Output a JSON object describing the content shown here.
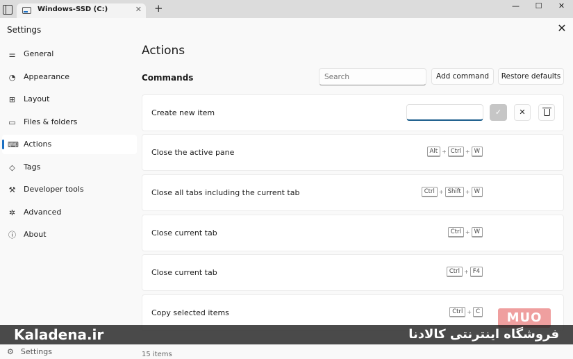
{
  "tab": {
    "label": "Windows-SSD (C:)",
    "close": "✕",
    "new": "+"
  },
  "window_controls": {
    "minimize": "—",
    "maximize": "☐",
    "close": "✕"
  },
  "dialog": {
    "title": "Settings",
    "close": "✕"
  },
  "sidebar": {
    "items": [
      {
        "label": "General",
        "icon": "sliders-icon"
      },
      {
        "label": "Appearance",
        "icon": "palette-icon"
      },
      {
        "label": "Layout",
        "icon": "grid-icon"
      },
      {
        "label": "Files & folders",
        "icon": "folder-icon"
      },
      {
        "label": "Actions",
        "icon": "keyboard-icon",
        "active": true
      },
      {
        "label": "Tags",
        "icon": "tag-icon"
      },
      {
        "label": "Developer tools",
        "icon": "tools-icon"
      },
      {
        "label": "Advanced",
        "icon": "advanced-icon"
      },
      {
        "label": "About",
        "icon": "info-icon"
      }
    ],
    "footer": {
      "label": "Settings",
      "icon": "gear-icon"
    }
  },
  "main": {
    "title": "Actions",
    "section": "Commands",
    "search_placeholder": "Search",
    "add_command": "Add command",
    "restore_defaults": "Restore defaults",
    "commands": [
      {
        "label": "Create new item",
        "editing": true,
        "keys": []
      },
      {
        "label": "Close the active pane",
        "keys": [
          "Alt",
          "Ctrl",
          "W"
        ]
      },
      {
        "label": "Close all tabs including the current tab",
        "keys": [
          "Ctrl",
          "Shift",
          "W"
        ]
      },
      {
        "label": "Close current tab",
        "keys": [
          "Ctrl",
          "W"
        ]
      },
      {
        "label": "Close current tab",
        "keys": [
          "Ctrl",
          "F4"
        ]
      },
      {
        "label": "Copy selected items",
        "keys": [
          "Ctrl",
          "C"
        ]
      }
    ],
    "item_count": "15 items"
  },
  "watermark": "MUO",
  "banner": {
    "left": "Kaladena.ir",
    "right": "فروشگاه اینترنتی کالادنا"
  },
  "colors": {
    "accent": "#1b6fc2",
    "background": "#f9f9f9",
    "row": "#ffffff"
  }
}
